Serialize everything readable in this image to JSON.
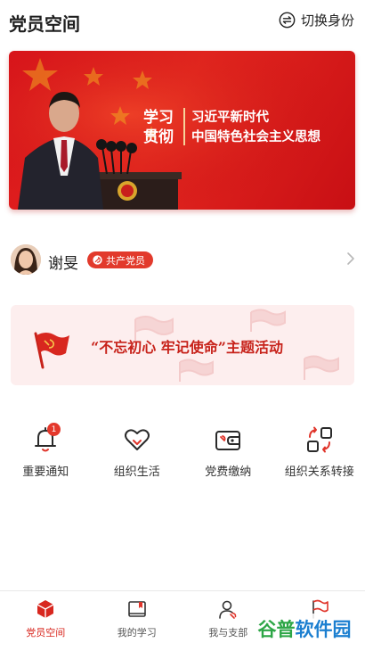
{
  "header": {
    "title": "党员空间",
    "switch_label": "切换身份",
    "switch_icon": "switch-arrows-icon"
  },
  "banner": {
    "left_text_line1": "学习",
    "left_text_line2": "贯彻",
    "right_text_line1": "习近平新时代",
    "right_text_line2": "中国特色社会主义思想",
    "colors": {
      "primary": "#d9141b",
      "accent": "#f6d39a"
    }
  },
  "profile": {
    "name": "谢旻",
    "badge_label": "共产党员",
    "badge_color": "#e23a2c"
  },
  "activity": {
    "title": "“不忘初心 牢记使命”主题活动",
    "text_color": "#c7221a",
    "background": "#fdeeee"
  },
  "shortcuts": [
    {
      "label": "重要通知",
      "icon": "bell-icon",
      "badge": "1"
    },
    {
      "label": "组织生活",
      "icon": "heart-icon"
    },
    {
      "label": "党费缴纳",
      "icon": "wallet-icon"
    },
    {
      "label": "组织关系转接",
      "icon": "transfer-icon"
    }
  ],
  "tabbar": {
    "active_color": "#d8271f",
    "items": [
      {
        "label": "党员空间",
        "icon": "cube-icon",
        "active": true
      },
      {
        "label": "我的学习",
        "icon": "book-icon"
      },
      {
        "label": "我与支部",
        "icon": "person-icon"
      },
      {
        "label": "",
        "icon": "flag-icon"
      }
    ]
  },
  "watermark": {
    "part1": "谷普",
    "part2": "软件园"
  }
}
